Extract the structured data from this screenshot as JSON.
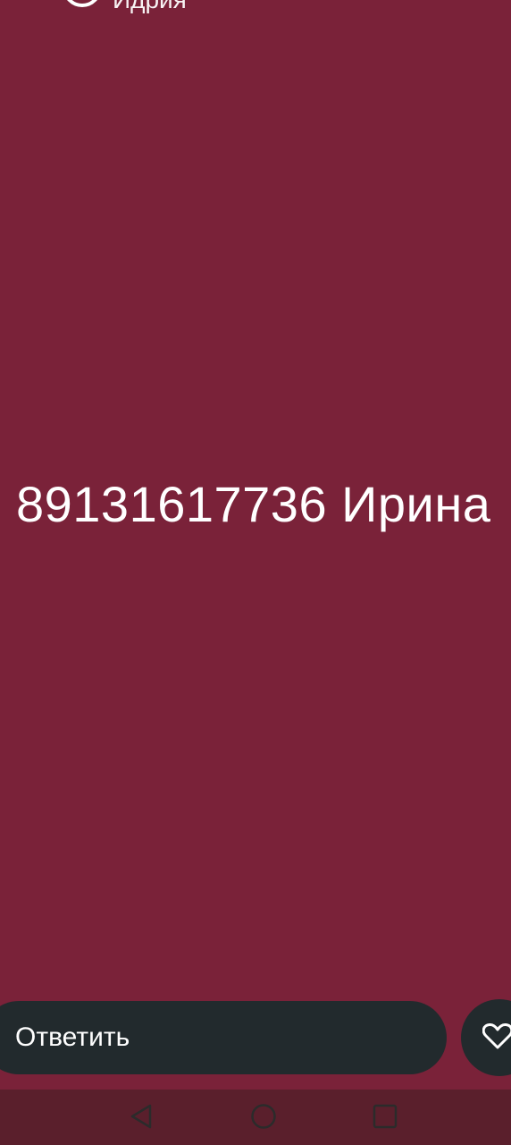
{
  "colors": {
    "background": "#7A2239",
    "reply_bar": "#222A2D",
    "nav_bar": "#5A1F2C",
    "text": "#ffffff"
  },
  "header": {
    "author_name": "Идрия"
  },
  "story": {
    "text": "89131617736 Ирина"
  },
  "reply": {
    "label": "Ответить"
  },
  "icons": {
    "like": "heart-icon",
    "back": "triangle-back-icon",
    "home": "circle-home-icon",
    "recent": "square-recent-icon"
  }
}
